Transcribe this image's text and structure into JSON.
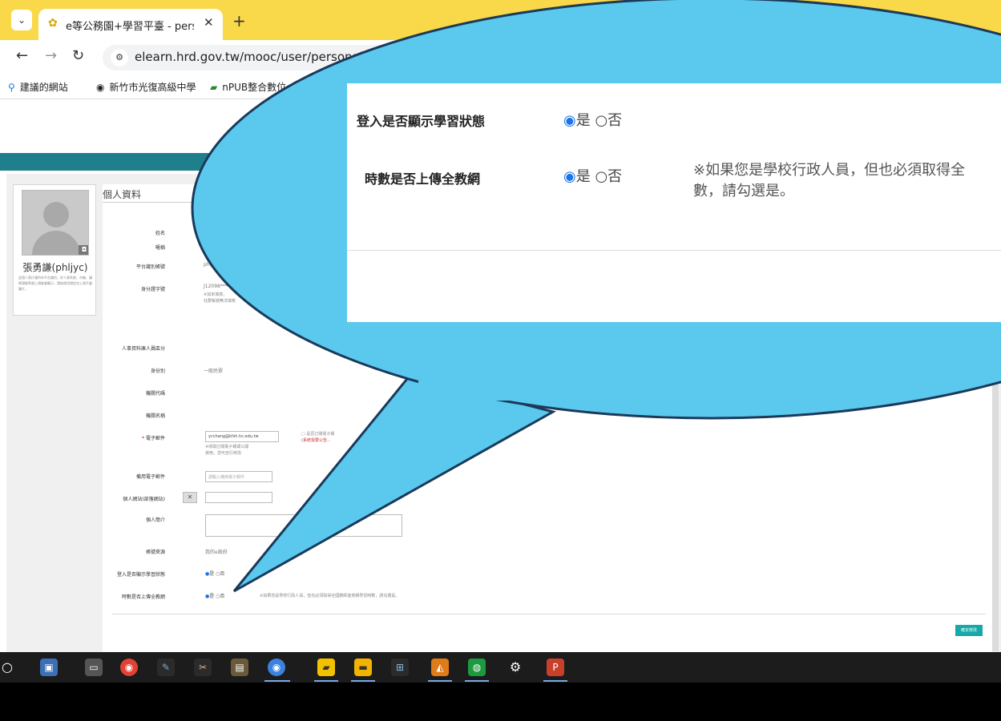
{
  "browser": {
    "tab_menu_icon": "⌄",
    "tab_title": "e等公務園+學習平臺 - persona",
    "tab_close": "✕",
    "new_tab": "+",
    "url": "elearn.hrd.gov.tw/mooc/user/personal.ph"
  },
  "bookmarks": [
    {
      "label": "建議的網站"
    },
    {
      "label": "新竹市光復高級中學"
    },
    {
      "label": "nPUB整合數位"
    }
  ],
  "profile": {
    "name": "張勇謙(phljyc)",
    "note": "此個人照片僅供本平台識別，於人資系統、市集、講師頭像等處上傳後會顯示，請依使用規定勿上傳不當圖片。"
  },
  "form": {
    "section_title": "個人資料",
    "fields": [
      {
        "label": "姓名",
        "value": ""
      },
      {
        "label": "暱稱",
        "value": ""
      },
      {
        "label": "平台識別帳號",
        "value": "phlj"
      },
      {
        "label": "身分證字號",
        "value": "J12098****"
      },
      {
        "label": "人事資料庫人員區分",
        "value": ""
      },
      {
        "label": "身份別",
        "value": "一般民眾"
      },
      {
        "label": "機關代碼",
        "value": ""
      },
      {
        "label": "機關名稱",
        "value": ""
      },
      {
        "label": "電子郵件",
        "value": "ycchang@kfsh.hc.edu.tw"
      },
      {
        "label": "備用電子郵件",
        "value": "請輸入備用電子郵件"
      },
      {
        "label": "個人網站(部落網站)",
        "value": ""
      },
      {
        "label": "個人簡介",
        "value": ""
      },
      {
        "label": "帳號來源",
        "value": "我的e政府"
      },
      {
        "label": "登入是否顯示學習狀態",
        "value": ""
      },
      {
        "label": "時數是否上傳全教網",
        "value": ""
      }
    ],
    "id_note_1": "※如未填寫，",
    "id_note_2": "社群帳號無法填寫",
    "email_note_1": "※收取訂閱電子報或公開",
    "email_note_2": "使用，您可自行修改",
    "subscribe_label": "□ 是否訂閱電子報",
    "subscribe_note": "(系統需要公告...",
    "clear_button": "✕",
    "radio_yes": "是",
    "radio_no": "否",
    "upload_note": "※如果您是學校行政人員，但也必須取得全國教師進修網學習時數，請勾選是。",
    "confirm_button": "確定修改"
  },
  "zoom": {
    "row1_label": "登入是否顯示學習狀態",
    "row2_label": "時數是否上傳全教網",
    "yes": "是",
    "no": "否",
    "note": "※如果您是學校行政人員，但也必須取得全數，請勾選是。",
    "note_line1": "※如果您是學校行政人員，但也必須取得全",
    "note_line2": "數，請勾選是。"
  },
  "colors": {
    "tabbar": "#f9d84a",
    "teal": "#1f7f8c",
    "bubble_fill": "#5bc8ee",
    "bubble_stroke": "#1a3a5a",
    "button": "#17a8a8"
  }
}
